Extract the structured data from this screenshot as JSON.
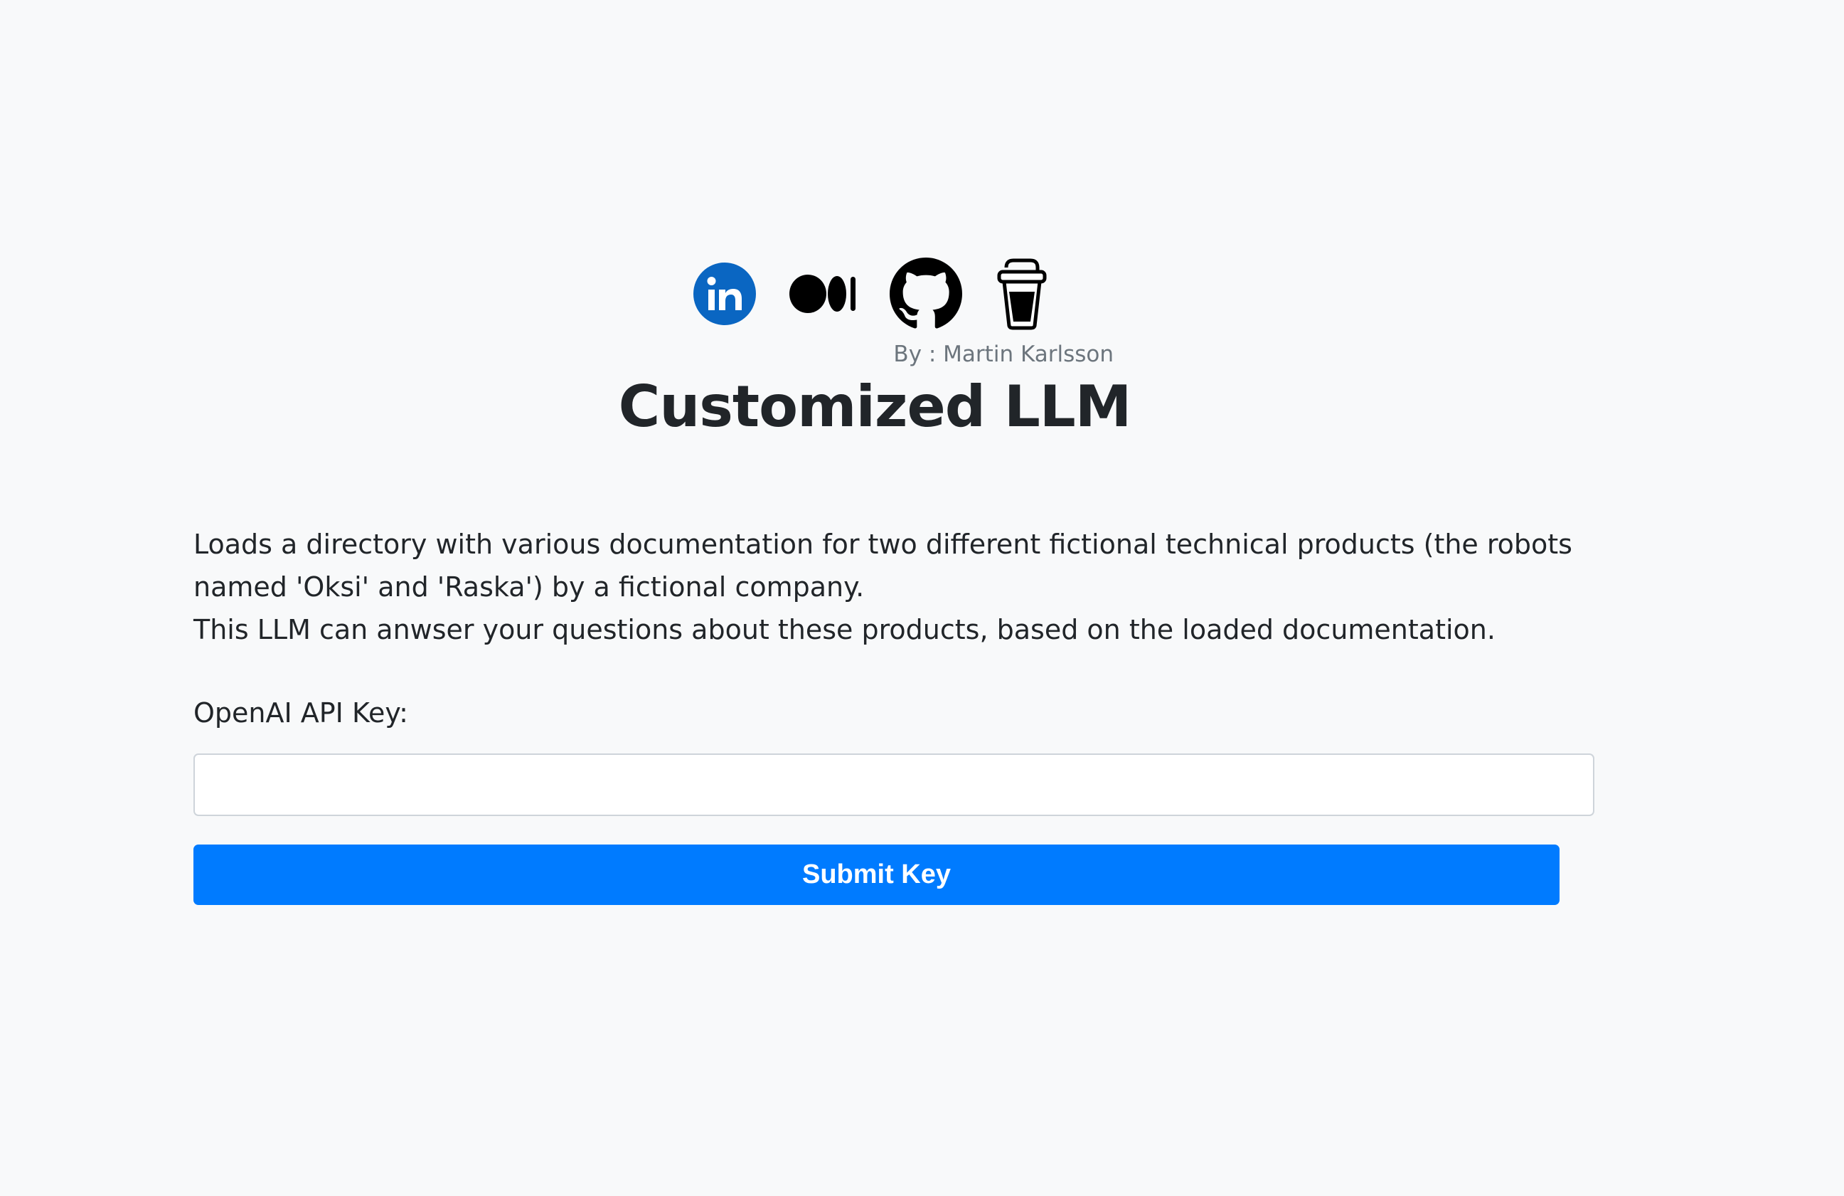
{
  "header": {
    "social_icons": [
      {
        "name": "linkedin-icon",
        "color": "#0a66c2"
      },
      {
        "name": "medium-icon",
        "color": "#000000"
      },
      {
        "name": "github-icon",
        "color": "#000000"
      },
      {
        "name": "buy-me-a-coffee-icon",
        "color": "#000000"
      }
    ],
    "byline": "By : Martin Karlsson",
    "title": "Customized LLM"
  },
  "description": {
    "paragraph1": "Loads a directory with various documentation for two different fictional technical products (the robots named 'Oksi' and 'Raska') by a fictional company.",
    "paragraph2": "This LLM can anwser your questions about these products, based on the loaded documentation."
  },
  "form": {
    "api_key_label": "OpenAI API Key:",
    "api_key_value": "",
    "submit_label": "Submit Key"
  },
  "colors": {
    "background": "#f8f9fa",
    "button": "#007bff",
    "muted_text": "#6c757d"
  }
}
